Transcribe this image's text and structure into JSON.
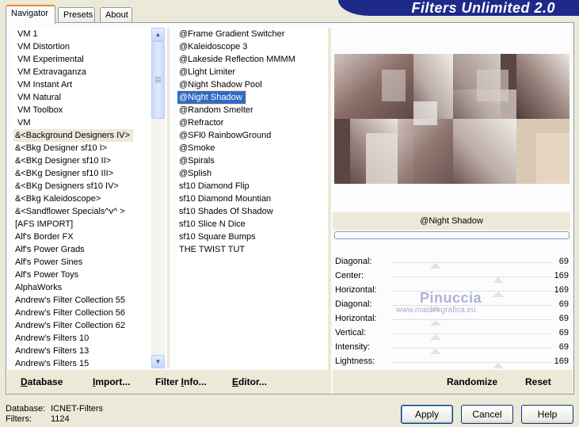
{
  "header": {
    "title": "Filters Unlimited 2.0"
  },
  "tabs": [
    "Navigator",
    "Presets",
    "About"
  ],
  "categories": [
    "VM 1",
    "VM Distortion",
    "VM Experimental",
    "VM Extravaganza",
    "VM Instant Art",
    "VM Natural",
    "VM Toolbox",
    "VM",
    "&<Background Designers IV>",
    "&<Bkg Designer sf10 I>",
    "&<BKg Designer sf10 II>",
    "&<BKg Designer sf10 III>",
    "&<BKg Designers sf10 IV>",
    "&<Bkg Kaleidoscope>",
    "&<Sandflower Specials^v^ >",
    "[AFS IMPORT]",
    "Alf's Border FX",
    "Alf's Power Grads",
    "Alf's Power Sines",
    "Alf's Power Toys",
    "AlphaWorks",
    "Andrew's Filter Collection 55",
    "Andrew's Filter Collection 56",
    "Andrew's Filter Collection 62",
    "Andrew's Filters 10",
    "Andrew's Filters 13",
    "Andrew's Filters 15"
  ],
  "selected_category": "&<Background Designers IV>",
  "filters": [
    "@Frame Gradient Switcher",
    "@Kaleidoscope 3",
    "@Lakeside Reflection MMMM",
    "@Light Limiter",
    "@Night Shadow Pool",
    "@Night Shadow",
    "@Random Smelter",
    "@Refractor",
    "@SFl0 RainbowGround",
    "@Smoke",
    "@Spirals",
    "@Splish",
    "sf10 Diamond Flip",
    "sf10 Diamond Mountian",
    "sf10 Shades Of Shadow",
    "sf10 Slice N Dice",
    "sf10 Square Bumps",
    "THE TWIST TUT"
  ],
  "selected_filter": "@Night Shadow",
  "preview": {
    "filter_name": "@Night Shadow",
    "watermark_name": "Pinuccia",
    "watermark_url": "www.maidiregrafica.eu"
  },
  "params": [
    {
      "label": "Diagonal:",
      "value": "69"
    },
    {
      "label": "Center:",
      "value": "169"
    },
    {
      "label": "Horizontal:",
      "value": "169"
    },
    {
      "label": "Diagonal:",
      "value": "69"
    },
    {
      "label": "Horizontal:",
      "value": "69"
    },
    {
      "label": "Vertical:",
      "value": "69"
    },
    {
      "label": "Intensity:",
      "value": "69"
    },
    {
      "label": "Lightness:",
      "value": "169"
    }
  ],
  "param_levels": [
    69,
    169,
    169,
    69,
    69,
    69,
    69,
    169
  ],
  "param_max": 255,
  "toolbar": {
    "database": "Database",
    "import": "Import...",
    "filter_info": "Filter Info...",
    "editor": "Editor...",
    "randomize": "Randomize",
    "reset": "Reset"
  },
  "status": {
    "database_label": "Database:",
    "database_value": "ICNET-Filters",
    "filters_label": "Filters:",
    "filters_value": "1124"
  },
  "buttons": {
    "apply": "Apply",
    "cancel": "Cancel",
    "help": "Help"
  }
}
